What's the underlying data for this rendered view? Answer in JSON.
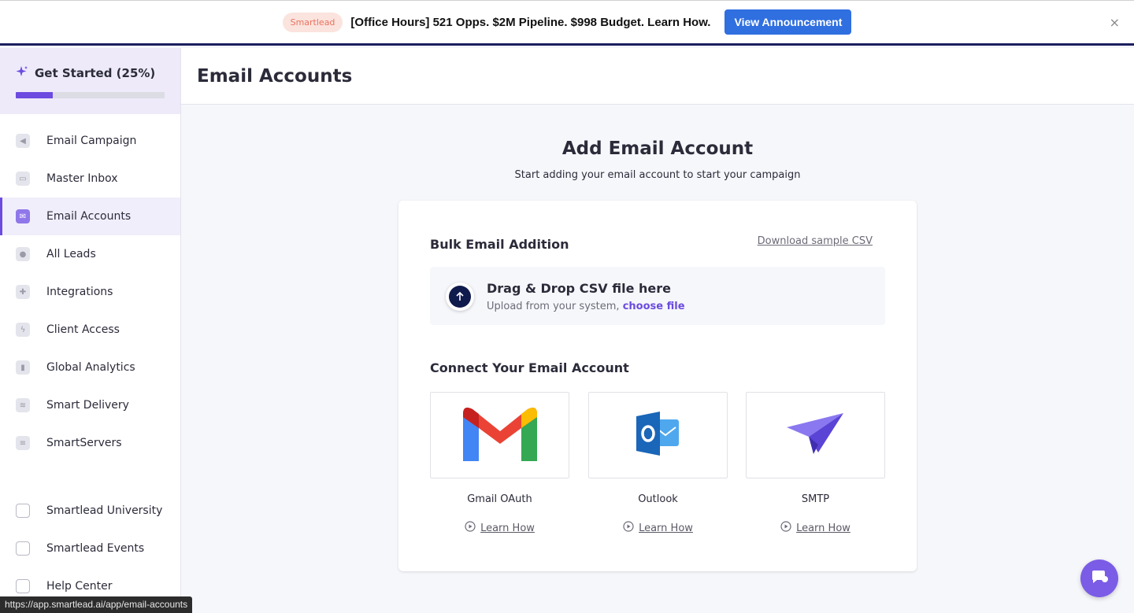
{
  "banner": {
    "tag": "Smartlead",
    "text": "[Office Hours] 521 Opps. $2M Pipeline. $998 Budget. Learn How.",
    "button": "View Announcement",
    "close": "×"
  },
  "sidebar": {
    "get_started": {
      "label": "Get Started (25%)",
      "progress": 0.25
    },
    "items": [
      {
        "label": "Email Campaign",
        "icon": "megaphone-icon",
        "active": false
      },
      {
        "label": "Master Inbox",
        "icon": "inbox-icon",
        "active": false
      },
      {
        "label": "Email Accounts",
        "icon": "mail-icon",
        "active": true
      },
      {
        "label": "All Leads",
        "icon": "leads-icon",
        "active": false
      },
      {
        "label": "Integrations",
        "icon": "puzzle-icon",
        "active": false
      },
      {
        "label": "Client Access",
        "icon": "bolt-icon",
        "active": false
      },
      {
        "label": "Global Analytics",
        "icon": "bar-chart-icon",
        "active": false
      },
      {
        "label": "Smart Delivery",
        "icon": "layers-icon",
        "active": false
      },
      {
        "label": "SmartServers",
        "icon": "server-icon",
        "active": false
      }
    ],
    "bottom_items": [
      {
        "label": "Smartlead University",
        "icon": "university-icon"
      },
      {
        "label": "Smartlead Events",
        "icon": "events-icon"
      },
      {
        "label": "Help Center",
        "icon": "help-book-icon"
      }
    ]
  },
  "header": {
    "title": "Email Accounts"
  },
  "main": {
    "title": "Add Email Account",
    "subtitle": "Start adding your email account to start your campaign",
    "bulk": {
      "title": "Bulk Email Addition",
      "download_link": "Download sample CSV",
      "drop_title": "Drag & Drop CSV file here",
      "drop_sub": "Upload from your system, ",
      "choose_file": "choose file"
    },
    "connect": {
      "title": "Connect Your Email Account",
      "providers": [
        {
          "name": "Gmail OAuth",
          "learn": "Learn How",
          "icon": "gmail-icon"
        },
        {
          "name": "Outlook",
          "learn": "Learn How",
          "icon": "outlook-icon"
        },
        {
          "name": "SMTP",
          "learn": "Learn How",
          "icon": "paper-plane-icon"
        }
      ]
    }
  },
  "status_url": "https://app.smartlead.ai/app/email-accounts",
  "colors": {
    "accent": "#6b4be0",
    "banner_button": "#2f6fe0",
    "banner_border": "#1b1f5e"
  }
}
